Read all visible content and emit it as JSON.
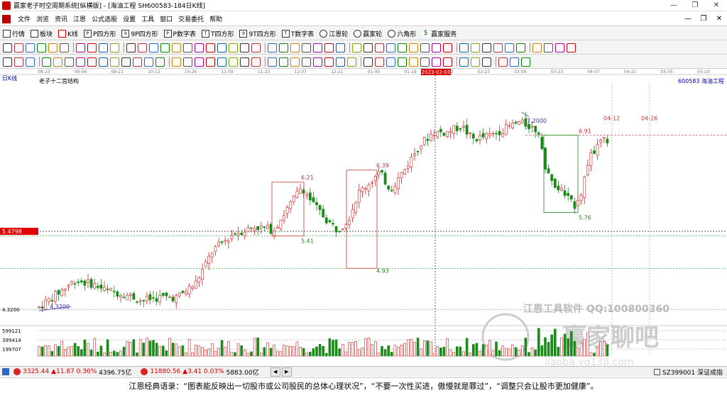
{
  "window": {
    "title": "赢家老子时空周期系统[纵横版] - [海油工程  SH600583-184日K线]",
    "controls": [
      "—",
      "❐",
      "✕"
    ]
  },
  "menu": {
    "items": [
      "文件",
      "浏览",
      "资讯",
      "江恩",
      "公式选股",
      "设置",
      "工具",
      "窗口",
      "交易委托",
      "帮助"
    ],
    "mdi_controls": [
      "—",
      "❐",
      "✕"
    ]
  },
  "toolbar1": {
    "items": [
      {
        "label": "行情",
        "icon": "grid-icon"
      },
      {
        "label": "板块",
        "icon": "blocks-icon"
      },
      {
        "label": "K线",
        "icon": "kline-icon"
      },
      {
        "label": "P四方形",
        "icon": "p-square-icon"
      },
      {
        "label": "9P四方形",
        "icon": "9p-square-icon"
      },
      {
        "label": "P数字表",
        "icon": "p-number-table-icon"
      },
      {
        "label": "T四方形",
        "icon": "t-square-icon"
      },
      {
        "label": "9T四方形",
        "icon": "9t-square-icon"
      },
      {
        "label": "T数字表",
        "icon": "t-number-table-icon"
      },
      {
        "label": "江恩轮",
        "icon": "gann-wheel-icon"
      },
      {
        "label": "赢家轮",
        "icon": "winner-wheel-icon"
      },
      {
        "label": "六角形",
        "icon": "hexagon-icon"
      },
      {
        "label": "赢家服务",
        "icon": "dollar-icon"
      }
    ]
  },
  "chart": {
    "period_label": "日K线",
    "structure_label": "老子十二宫结构",
    "stock_label": "600583 海油工程",
    "time_axis": [
      "08-23",
      "09-06",
      "09-21",
      "10-12",
      "10-26",
      "11-09",
      "11-23",
      "12-07",
      "12-21",
      "01-05",
      "01-19",
      "02-03",
      "02-23",
      "03-09",
      "03-23",
      "04-07",
      "04-21",
      "05-05",
      "05-19"
    ],
    "cursor_date": "2023-02-03",
    "price_tag": "5.4798",
    "low_price_label": "4.3200",
    "volume_axis": [
      "599121",
      "399414",
      "199707"
    ],
    "annotations": [
      "4.3200",
      "6.21",
      "5.41",
      "6.39",
      "4.93",
      "7.2000",
      "6.91",
      "5.76",
      "04-12",
      "04-26"
    ],
    "watermark_text": "江恩工具软件  QQ:100800360",
    "watermark_forum": "赢家聊吧",
    "watermark_url": "liaoba.yq138.com",
    "colors": {
      "up": "#d42020",
      "down": "#1a8a1a",
      "box_red": "#c83232",
      "box_green": "#1a8a1a",
      "blue": "#3030b0",
      "price_tag": "#e00000"
    }
  },
  "chart_data": {
    "type": "candlestick",
    "title": "海油工程 SH600583 日K线",
    "xlabel": "",
    "ylabel": "",
    "ylim": [
      4.1,
      7.6
    ],
    "low": 4.32,
    "high": 7.2,
    "key_levels": [
      {
        "label": "6.21",
        "value": 6.21
      },
      {
        "label": "5.41",
        "value": 5.41
      },
      {
        "label": "6.39",
        "value": 6.39
      },
      {
        "label": "4.93",
        "value": 4.93
      },
      {
        "label": "7.2000",
        "value": 7.2
      },
      {
        "label": "6.91",
        "value": 6.91
      },
      {
        "label": "5.76",
        "value": 5.76
      }
    ]
  },
  "status": {
    "sh_index": "3325.44",
    "sh_change": "▲11.87",
    "sh_pct": "0.36%",
    "sh_amount": "4396.75亿",
    "sz_index": "11880.56",
    "sz_change": "▲3.41",
    "sz_pct": "0.03%",
    "sz_amount": "5883.00亿",
    "right_label": "SZ399001 深证成指"
  },
  "quote": "江恩经典语录：“图表能反映出一切股市或公司股民的总体心理状况”，“不要一次性买进，傲慢就是罪过”，“调整只会让股市更加健康”。"
}
